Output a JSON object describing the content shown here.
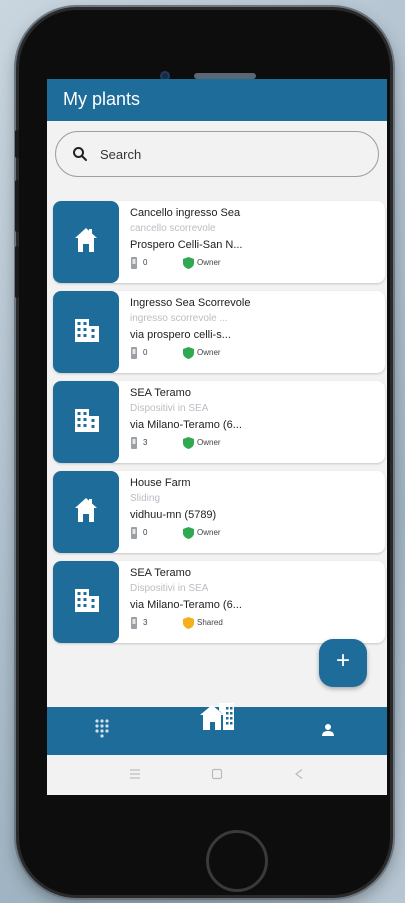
{
  "app": {
    "title": "My plants"
  },
  "search": {
    "placeholder": "Search"
  },
  "plants": [
    {
      "icon": "house-icon",
      "name": "Cancello ingresso Sea",
      "description": "cancello scorrevole",
      "address": "Prospero Celli-San N...",
      "count": "0",
      "role": "Owner",
      "role_color": "#2fa84f"
    },
    {
      "icon": "building-icon",
      "name": "Ingresso Sea Scorrevole",
      "description": "ingresso scorrevole ...",
      "address": "via prospero celli-s...",
      "count": "0",
      "role": "Owner",
      "role_color": "#2fa84f"
    },
    {
      "icon": "building-icon",
      "name": "SEA Teramo",
      "description": "Dispositivi in SEA",
      "address": "via Milano-Teramo (6...",
      "count": "3",
      "role": "Owner",
      "role_color": "#2fa84f"
    },
    {
      "icon": "house-icon",
      "name": "House Farm",
      "description": "Sliding",
      "address": "vidhuu-mn (5789)",
      "count": "0",
      "role": "Owner",
      "role_color": "#2fa84f"
    },
    {
      "icon": "building-icon",
      "name": "SEA Teramo",
      "description": "Dispositivi in SEA",
      "address": "via Milano-Teramo (6...",
      "count": "3",
      "role": "Shared",
      "role_color": "#f2b01e"
    }
  ],
  "fab": {
    "label": "+"
  },
  "bottom_nav": {
    "items": [
      "dialpad-icon",
      "home-plants-icon",
      "person-icon"
    ],
    "active": "home-plants-icon"
  },
  "system_nav": {
    "items": [
      "recent-apps-icon",
      "home-square-icon",
      "back-icon"
    ]
  },
  "colors": {
    "primary": "#1e6c99",
    "owner": "#2fa84f",
    "shared": "#f2b01e"
  }
}
